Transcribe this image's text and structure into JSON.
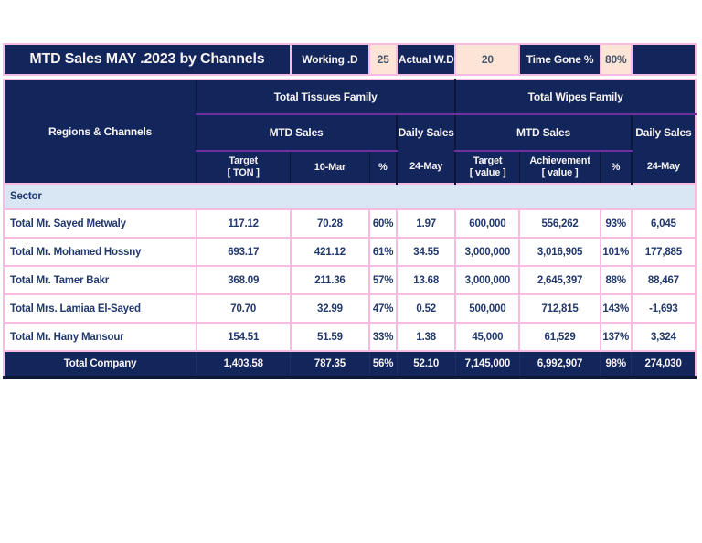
{
  "banner": {
    "title": "MTD Sales MAY .2023 by Channels",
    "working_days": {
      "label": "Working .D",
      "value": "25"
    },
    "actual_wd": {
      "label": "Actual W.D",
      "value": "20"
    },
    "time_gone": {
      "label": "Time Gone %",
      "value": "80%"
    }
  },
  "header": {
    "corner": "Regions & Channels",
    "group_tissues": "Total Tissues Family",
    "group_wipes": "Total Wipes Family",
    "mtd_sales": "MTD Sales",
    "daily_sales": "Daily Sales",
    "sub": {
      "target_ton": "Target\n[ TON ]",
      "date_col": "10-Mar",
      "pct": "%",
      "daily_date": "24-May",
      "target_value": "Target\n[ value ]",
      "achievement_value": "Achievement\n[ value ]"
    }
  },
  "section": {
    "label": "Sector"
  },
  "rows": [
    {
      "name": "Total Mr. Sayed Metwaly",
      "c": [
        "117.12",
        "70.28",
        "60%",
        "1.97",
        "600,000",
        "556,262",
        "93%",
        "6,045"
      ]
    },
    {
      "name": "Total Mr. Mohamed Hossny",
      "c": [
        "693.17",
        "421.12",
        "61%",
        "34.55",
        "3,000,000",
        "3,016,905",
        "101%",
        "177,885"
      ]
    },
    {
      "name": "Total Mr. Tamer Bakr",
      "c": [
        "368.09",
        "211.36",
        "57%",
        "13.68",
        "3,000,000",
        "2,645,397",
        "88%",
        "88,467"
      ]
    },
    {
      "name": "Total Mrs. Lamiaa El-Sayed",
      "c": [
        "70.70",
        "32.99",
        "47%",
        "0.52",
        "500,000",
        "712,815",
        "143%",
        "-1,693"
      ]
    },
    {
      "name": "Total Mr. Hany Mansour",
      "c": [
        "154.51",
        "51.59",
        "33%",
        "1.38",
        "45,000",
        "61,529",
        "137%",
        "3,324"
      ]
    }
  ],
  "total": {
    "name": "Total Company",
    "c": [
      "1,403.58",
      "787.35",
      "56%",
      "52.10",
      "7,145,000",
      "6,992,907",
      "98%",
      "274,030"
    ]
  },
  "colors": {
    "navy": "#13265c",
    "peach": "#fce4d6",
    "pink_grid": "#f8bce2",
    "purple_rule": "#7030a0",
    "sector_bg": "#d9e7f5"
  }
}
